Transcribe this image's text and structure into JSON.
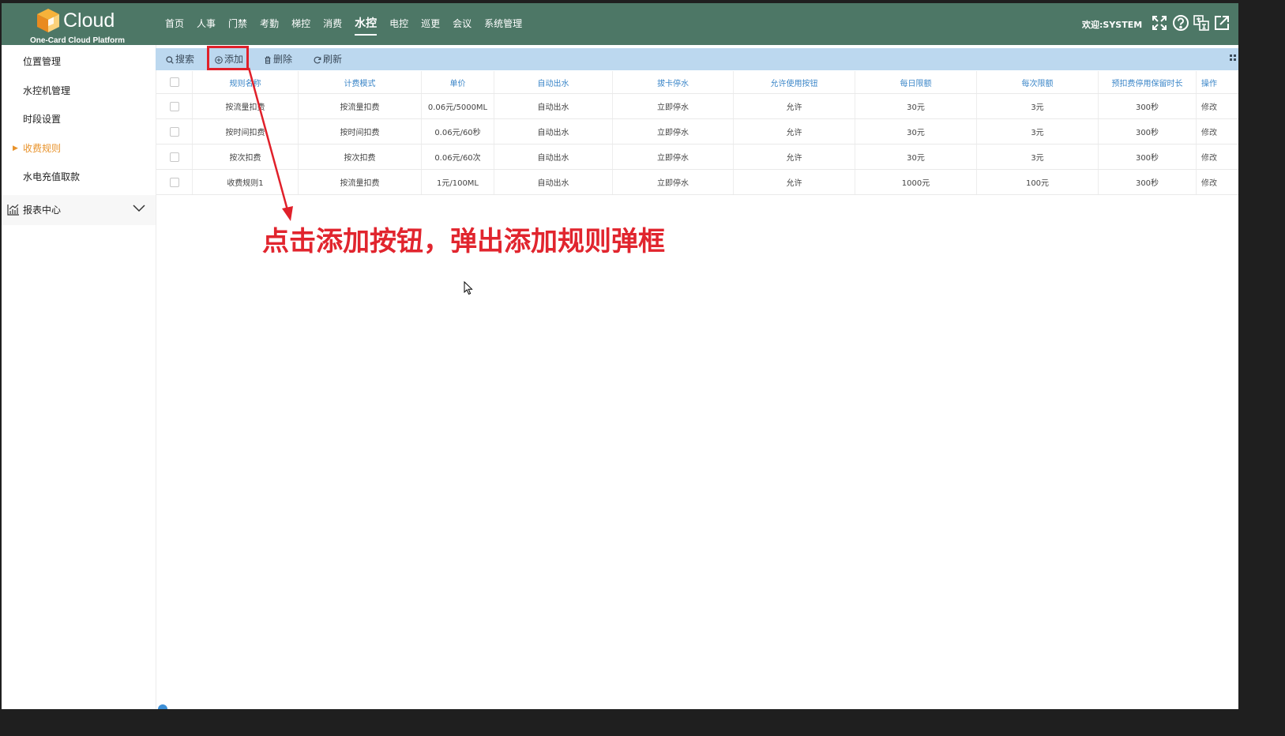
{
  "brand": {
    "name": "Cloud",
    "subtitle": "One-Card Cloud Platform"
  },
  "topnav": {
    "items": [
      {
        "label": "首页"
      },
      {
        "label": "人事"
      },
      {
        "label": "门禁"
      },
      {
        "label": "考勤"
      },
      {
        "label": "梯控"
      },
      {
        "label": "消费"
      },
      {
        "label": "水控"
      },
      {
        "label": "电控"
      },
      {
        "label": "巡更"
      },
      {
        "label": "会议"
      },
      {
        "label": "系统管理"
      }
    ],
    "active": "水控"
  },
  "user": {
    "welcome": "欢迎:SYSTEM"
  },
  "header_icons": [
    "fullscreen-icon",
    "help-icon",
    "language-icon",
    "logout-icon"
  ],
  "sidebar": {
    "items": [
      {
        "label": "位置管理"
      },
      {
        "label": "水控机管理"
      },
      {
        "label": "时段设置"
      },
      {
        "label": "收费规则"
      },
      {
        "label": "水电充值取款"
      }
    ],
    "active": "收费规则",
    "group": {
      "label": "报表中心"
    }
  },
  "toolbar": {
    "search": "搜索",
    "add": "添加",
    "delete": "删除",
    "refresh": "刷新"
  },
  "table": {
    "columns": [
      "规则名称",
      "计费模式",
      "单价",
      "自动出水",
      "拔卡停水",
      "允许使用按钮",
      "每日限额",
      "每次限额",
      "预扣费停用保留时长",
      "操作"
    ],
    "rows": [
      [
        "按流量扣费",
        "按流量扣费",
        "0.06元/5000ML",
        "自动出水",
        "立即停水",
        "允许",
        "30元",
        "3元",
        "300秒",
        "修改"
      ],
      [
        "按时间扣费",
        "按时间扣费",
        "0.06元/60秒",
        "自动出水",
        "立即停水",
        "允许",
        "30元",
        "3元",
        "300秒",
        "修改"
      ],
      [
        "按次扣费",
        "按次扣费",
        "0.06元/60次",
        "自动出水",
        "立即停水",
        "允许",
        "30元",
        "3元",
        "300秒",
        "修改"
      ],
      [
        "收费规则1",
        "按流量扣费",
        "1元/100ML",
        "自动出水",
        "立即停水",
        "允许",
        "1000元",
        "100元",
        "300秒",
        "修改"
      ]
    ]
  },
  "annotation": {
    "text": "点击添加按钮，弹出添加规则弹框",
    "color": "#e1252e"
  },
  "colors": {
    "header": "#4d7766",
    "toolbar": "#bcd8ef",
    "active_sidebar": "#e8922a",
    "column_header": "#3b86c8"
  }
}
